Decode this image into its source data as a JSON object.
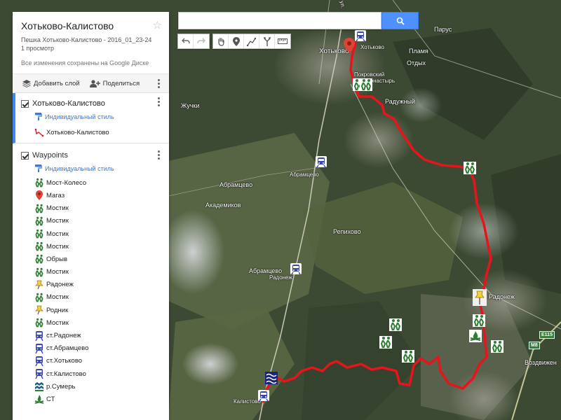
{
  "search": {
    "value": "",
    "placeholder": ""
  },
  "toolbar": {
    "buttons": [
      "undo-icon",
      "redo-icon",
      "hand-icon",
      "marker-icon",
      "line-icon",
      "route-icon",
      "ruler-icon"
    ]
  },
  "panel": {
    "title": "Хотьково-Калистово",
    "description": "Пешка Хотьково-Калистово - 2016_01_23-24",
    "views": "1 просмотр",
    "saved": "Все изменения сохранены на Google Диске",
    "add_layer": "Добавить слой",
    "share": "Поделиться"
  },
  "layers": [
    {
      "name": "Хотьково-Калистово",
      "style": "Индивидуальный стиль",
      "items": [
        {
          "label": "Хотьково-Калистово",
          "icon": "route-line-icon"
        }
      ]
    },
    {
      "name": "Waypoints",
      "style": "Индивидуальный стиль",
      "items": [
        {
          "label": "Мост-Колесо",
          "icon": "hikers-icon"
        },
        {
          "label": "Магаз",
          "icon": "pin-icon"
        },
        {
          "label": "Мостик",
          "icon": "hikers-icon"
        },
        {
          "label": "Мостик",
          "icon": "hikers-icon"
        },
        {
          "label": "Мостик",
          "icon": "hikers-icon"
        },
        {
          "label": "Мостик",
          "icon": "hikers-icon"
        },
        {
          "label": "Обрыв",
          "icon": "hikers-icon"
        },
        {
          "label": "Мостик",
          "icon": "hikers-icon"
        },
        {
          "label": "Радонеж",
          "icon": "pushpin-icon"
        },
        {
          "label": "Мостик",
          "icon": "hikers-icon"
        },
        {
          "label": "Родник",
          "icon": "pushpin-icon"
        },
        {
          "label": "Мостик",
          "icon": "hikers-icon"
        },
        {
          "label": "ст.Радонеж",
          "icon": "train-icon"
        },
        {
          "label": "ст.Абрамцево",
          "icon": "train-icon"
        },
        {
          "label": "ст.Хотьково",
          "icon": "train-icon"
        },
        {
          "label": "ст.Калистово",
          "icon": "train-icon"
        },
        {
          "label": "р.Сумерь",
          "icon": "water-icon"
        },
        {
          "label": "СТ",
          "icon": "campfire-icon"
        }
      ]
    }
  ],
  "map_labels": {
    "hotkovo": "Хотьково",
    "hotkovo_station": "Хотьково",
    "parus": "Парус",
    "plamya": "Пламя",
    "otdyh": "Отдых",
    "pokrovsky1": "Покровский",
    "pokrovsky2": "ов Монастырь",
    "raduzhny": "Радужный",
    "zhuchki": "Жучки",
    "abramtsevo_station": "Абрамцево",
    "abramtsevo": "Абрамцево",
    "akademikov": "Академиков",
    "repihovo": "Репихово",
    "abramtsevo2": "Абрамцево",
    "radonezh_station": "Радонеж",
    "radonezh": "Радонеж",
    "kalistovo": "Калистово",
    "vozdvizhen": "Воздвижен",
    "ul_vertical": "ул.",
    "road_e115": "E115",
    "road_m8": "M8"
  },
  "colors": {
    "route": "#e8141c",
    "accent": "#4285f4",
    "search_button": "#4d90fe",
    "hiker_icon": "#2e7d32",
    "train_icon": "#3949ab",
    "pushpin": "#f4d03f",
    "marker_red": "#db4437"
  }
}
